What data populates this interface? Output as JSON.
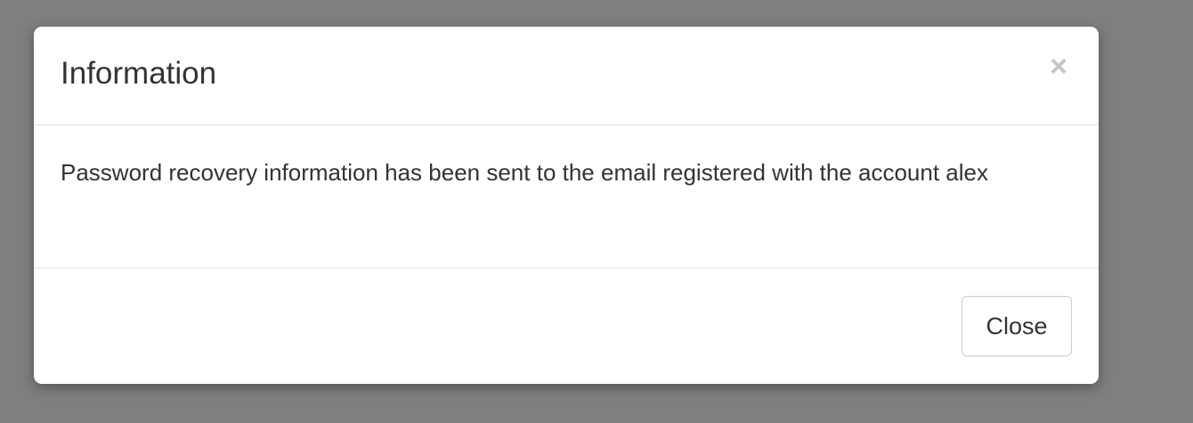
{
  "modal": {
    "title": "Information",
    "close_icon_glyph": "×",
    "message": "Password recovery information has been sent to the email registered with the account alex",
    "close_button_label": "Close"
  },
  "icons": {
    "dismiss": "close-icon"
  },
  "colors": {
    "backdrop": "#7f7f7f",
    "modal_bg": "#ffffff",
    "text": "#333333",
    "divider": "#e5e5e5",
    "close_icon": "#c4c4c4",
    "button_border": "#cccccc"
  }
}
